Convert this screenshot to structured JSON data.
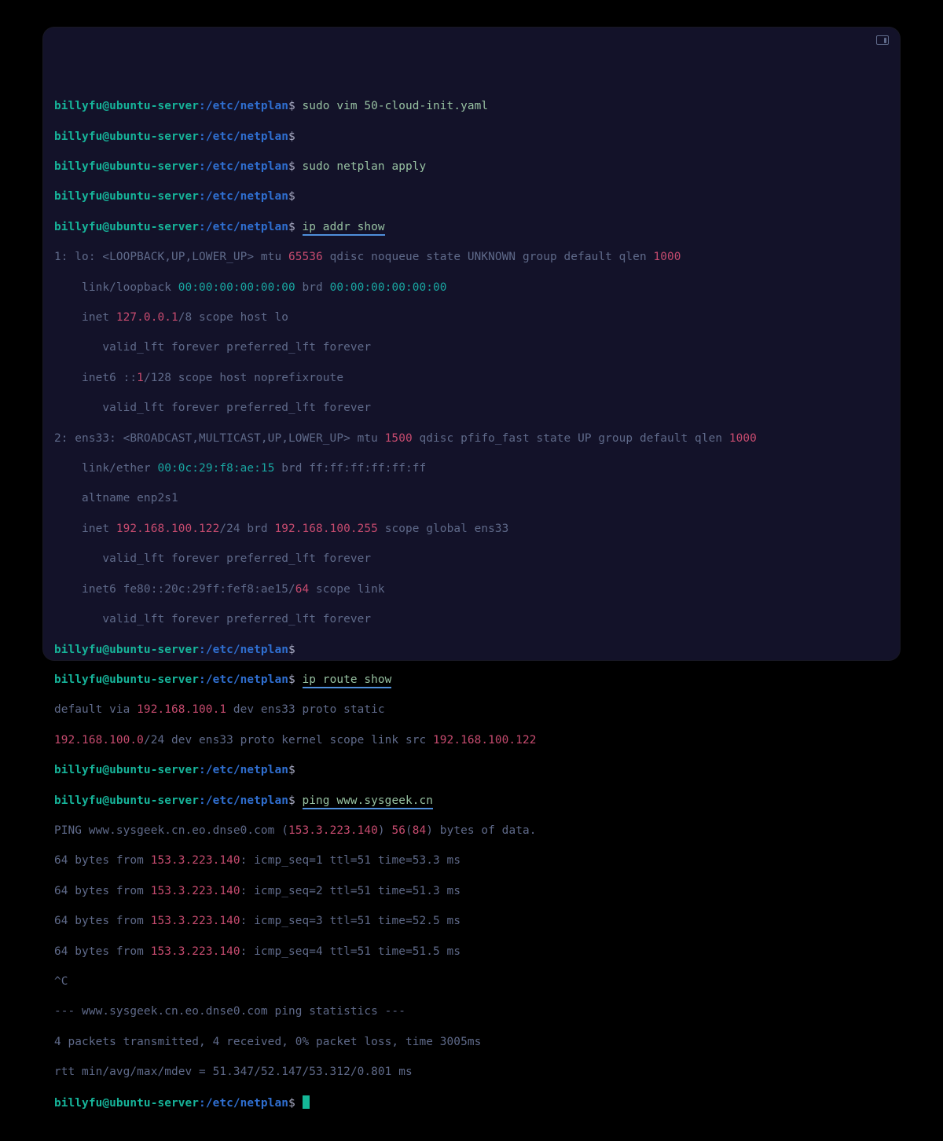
{
  "prompt": {
    "user": "billyfu@ubuntu-server",
    "path": "/etc/netplan",
    "sep1": ":",
    "sep2": "$"
  },
  "cmds": {
    "c1": " sudo vim 50-cloud-init.yaml",
    "c2": " sudo netplan apply",
    "c3": " ",
    "c3u": "ip addr show",
    "c4": " ",
    "c4u": "ip route show",
    "c5": " ",
    "c5u": "ping www.sysgeek.cn"
  },
  "ip_addr": {
    "l1a": "1: lo: <LOOPBACK,UP,LOWER_UP> mtu ",
    "l1b": "65536",
    "l1c": " qdisc noqueue state UNKNOWN group default qlen ",
    "l1d": "1000",
    "l2a": "    link/loopback ",
    "l2b": "00:00:00:00:00:00",
    "l2c": " brd ",
    "l2d": "00:00:00:00:00:00",
    "l3a": "    inet ",
    "l3b": "127.0.0.1",
    "l3c": "/8 scope host lo",
    "l4": "       valid_lft forever preferred_lft forever",
    "l5a": "    inet6 ::",
    "l5b": "1",
    "l5c": "/128 scope host noprefixroute",
    "l6": "       valid_lft forever preferred_lft forever",
    "l7a": "2: ens33: <BROADCAST,MULTICAST,UP,LOWER_UP> mtu ",
    "l7b": "1500",
    "l7c": " qdisc pfifo_fast state UP group default qlen ",
    "l7d": "1000",
    "l8a": "    link/ether ",
    "l8b": "00:0c:29:f8:ae:15",
    "l8c": " brd ff:ff:ff:ff:ff:ff",
    "l9": "    altname enp2s1",
    "l10a": "    inet ",
    "l10b": "192.168.100.122",
    "l10c": "/24 brd ",
    "l10d": "192.168.100.255",
    "l10e": " scope global ens33",
    "l11": "       valid_lft forever preferred_lft forever",
    "l12a": "    inet6 fe80::20c:29ff:fef8:ae15/",
    "l12b": "64",
    "l12c": " scope link",
    "l13": "       valid_lft forever preferred_lft forever"
  },
  "ip_route": {
    "l1a": "default via ",
    "l1b": "192.168.100.1",
    "l1c": " dev ens33 proto static",
    "l2a": "192.168.100.0",
    "l2b": "/24 dev ens33 proto kernel scope link src ",
    "l2c": "192.168.100.122"
  },
  "ping": {
    "l1a": "PING www.sysgeek.cn.eo.dnse0.com (",
    "l1b": "153.3.223.140",
    "l1c": ") ",
    "l1d": "56",
    "l1e": "(",
    "l1f": "84",
    "l1g": ") bytes of data.",
    "r1a": "64 bytes from ",
    "ip": "153.3.223.140",
    "r1b": ": icmp_seq=1 ttl=51 time=53.3 ms",
    "r2b": ": icmp_seq=2 ttl=51 time=51.3 ms",
    "r3b": ": icmp_seq=3 ttl=51 time=52.5 ms",
    "r4b": ": icmp_seq=4 ttl=51 time=51.5 ms",
    "ctrlc": "^C",
    "s1": "--- www.sysgeek.cn.eo.dnse0.com ping statistics ---",
    "s2": "4 packets transmitted, 4 received, 0% packet loss, time 3005ms",
    "s3": "rtt min/avg/max/mdev = 51.347/52.147/53.312/0.801 ms"
  }
}
